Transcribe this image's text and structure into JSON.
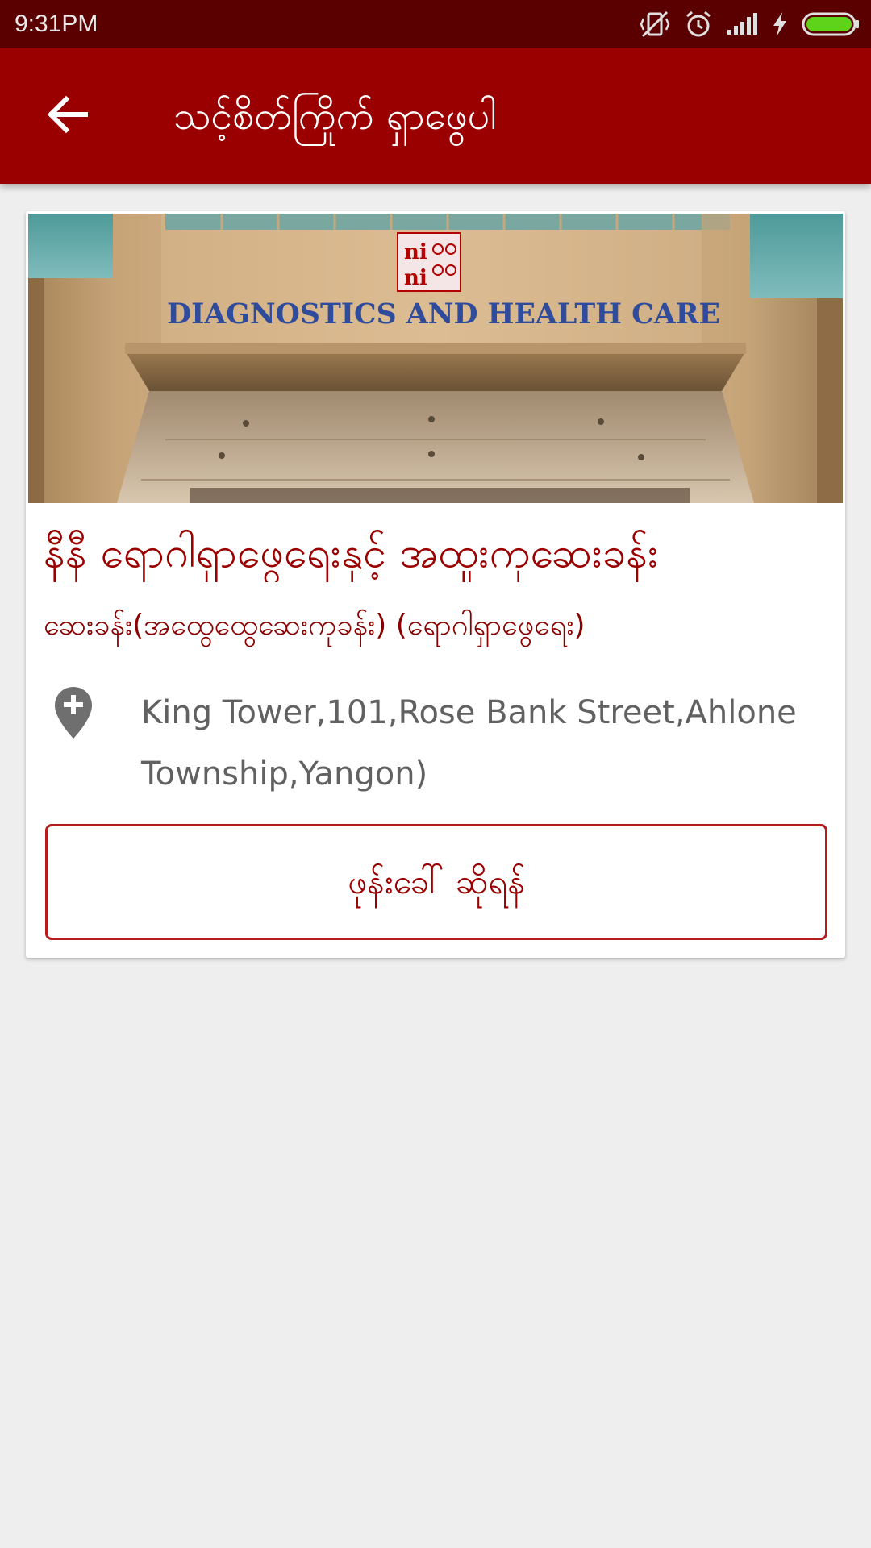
{
  "status_bar": {
    "time": "9:31PM",
    "icons": [
      "vibrate-off-icon",
      "alarm-icon",
      "signal-icon",
      "charging-icon",
      "battery-icon"
    ]
  },
  "app_bar": {
    "title": "သင့်စိတ်ကြိုက် ရှာဖွေပါ",
    "back_icon": "arrow-left-icon",
    "background_color": "#9b0000"
  },
  "card": {
    "photo_sign": "DIAGNOSTICS AND HEALTH CARE",
    "logo_text": "ni ni",
    "hospital_name": "နီနီ ရောဂါရှာဖွေရေးနှင့် အထူးကုဆေးခန်း",
    "category": "ဆေးခန်း(အထွေထွေဆေးကုခန်း) (ရောဂါရှာဖွေရေး)",
    "address_icon": "location-pin-plus-icon",
    "address": "King Tower,101,Rose Bank Street,Ahlone Township,Yangon)",
    "call_button_label": "ဖုန်းခေါ် ဆိုရန်"
  },
  "colors": {
    "accent": "#9b0000",
    "status_bar": "#5a0000",
    "background": "#eeeeee",
    "address_text": "#616161"
  }
}
